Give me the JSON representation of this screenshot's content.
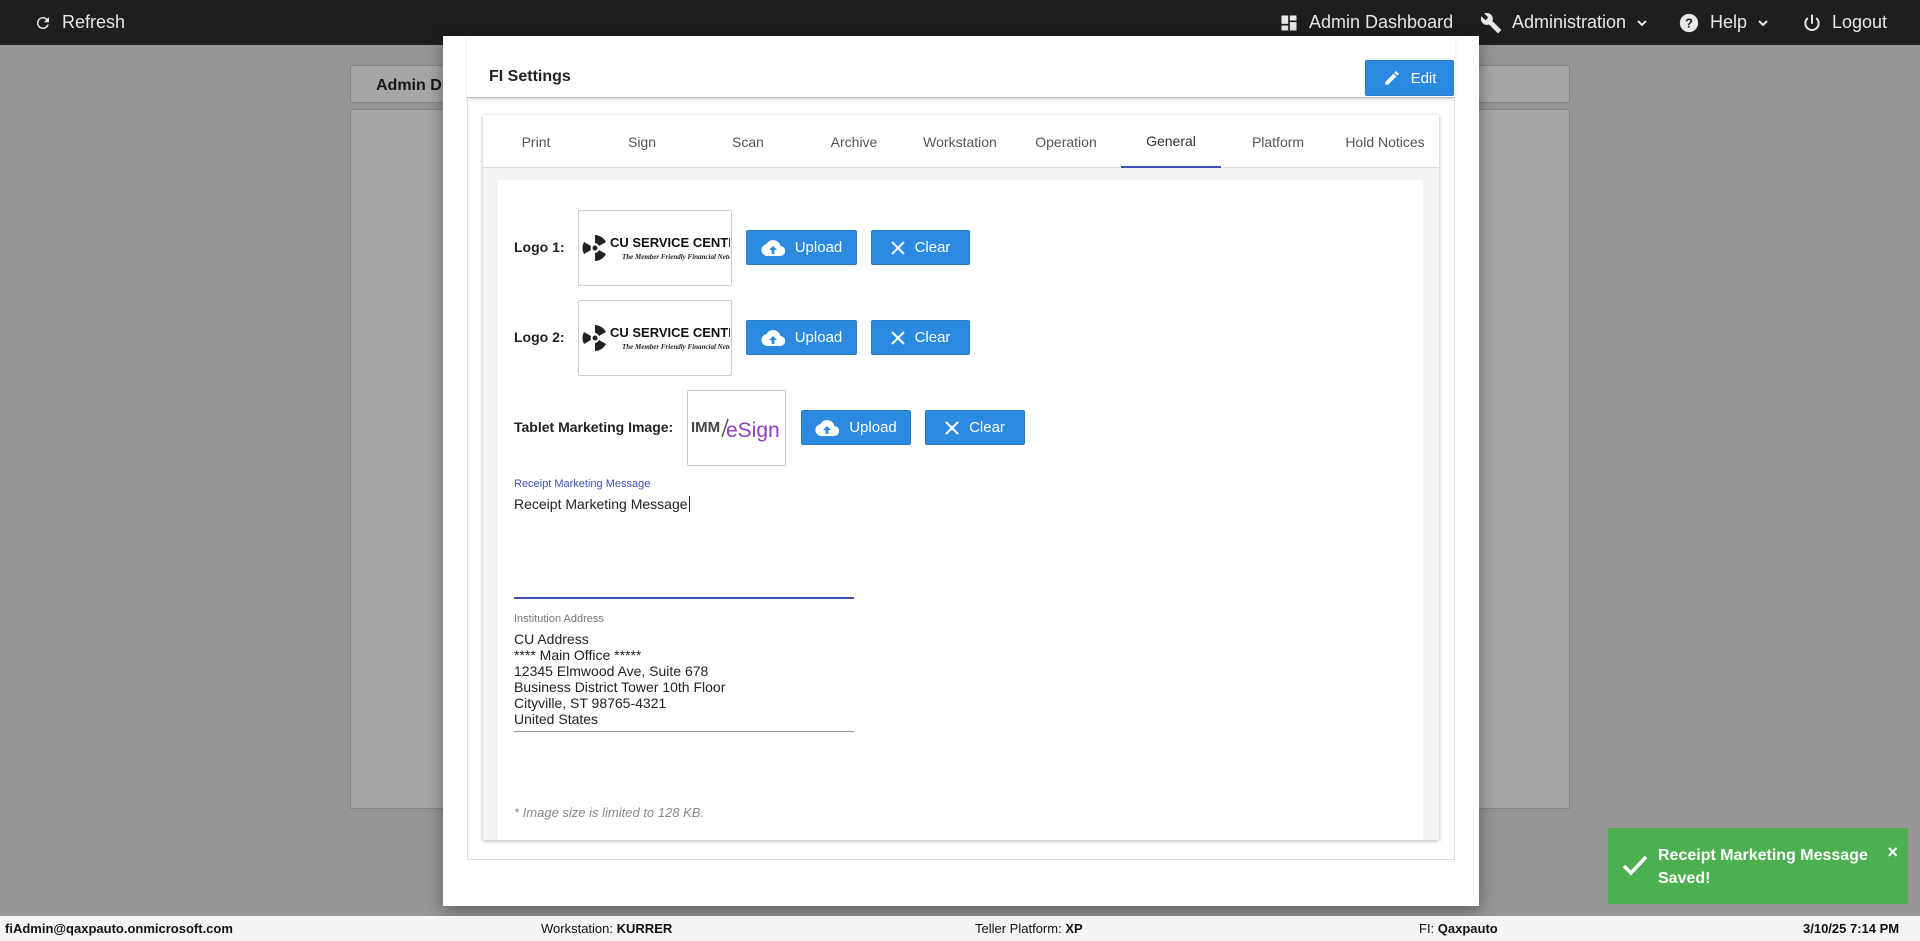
{
  "topbar": {
    "refresh": "Refresh",
    "admin_dashboard": "Admin Dashboard",
    "administration": "Administration",
    "help": "Help",
    "logout": "Logout"
  },
  "background": {
    "header_title": "Admin D"
  },
  "modal": {
    "title": "FI Settings",
    "edit_label": "Edit",
    "tabs": [
      "Print",
      "Sign",
      "Scan",
      "Archive",
      "Workstation",
      "Operation",
      "General",
      "Platform",
      "Hold Notices"
    ],
    "active_tab": "General",
    "general": {
      "logo1_label": "Logo 1:",
      "logo2_label": "Logo 2:",
      "tablet_label": "Tablet Marketing Image:",
      "upload_label": "Upload",
      "clear_label": "Clear",
      "logo_brand": "CU SERVICE CENTERS",
      "logo_tagline": "The Member Friendly Financial Network",
      "tablet_logo_left": "IMM",
      "tablet_logo_right": "eSign",
      "receipt_label": "Receipt Marketing Message",
      "receipt_value": "Receipt Marketing Message",
      "address_label": "Institution Address",
      "address_value": "CU Address\n**** Main Office *****\n12345 Elmwood Ave, Suite 678\nBusiness District Tower 10th Floor\nCityville, ST 98765-4321\nUnited States",
      "note": "* Image size is limited to 128 KB."
    }
  },
  "toast": {
    "message": "Receipt Marketing Message Saved!",
    "close": "×"
  },
  "footer": {
    "user": "fiAdmin@qaxpauto.onmicrosoft.com",
    "workstation_label": "Workstation:",
    "workstation_value": "KURRER",
    "teller_label": "Teller Platform:",
    "teller_value": "XP",
    "fi_label": "FI:",
    "fi_value": "Qaxpauto",
    "datetime": "3/10/25 7:14 PM"
  },
  "colors": {
    "accent": "#2b8ae0",
    "tab_active": "#3f51b5",
    "toast": "#4caf50",
    "topbar": "#1e1e1e"
  }
}
